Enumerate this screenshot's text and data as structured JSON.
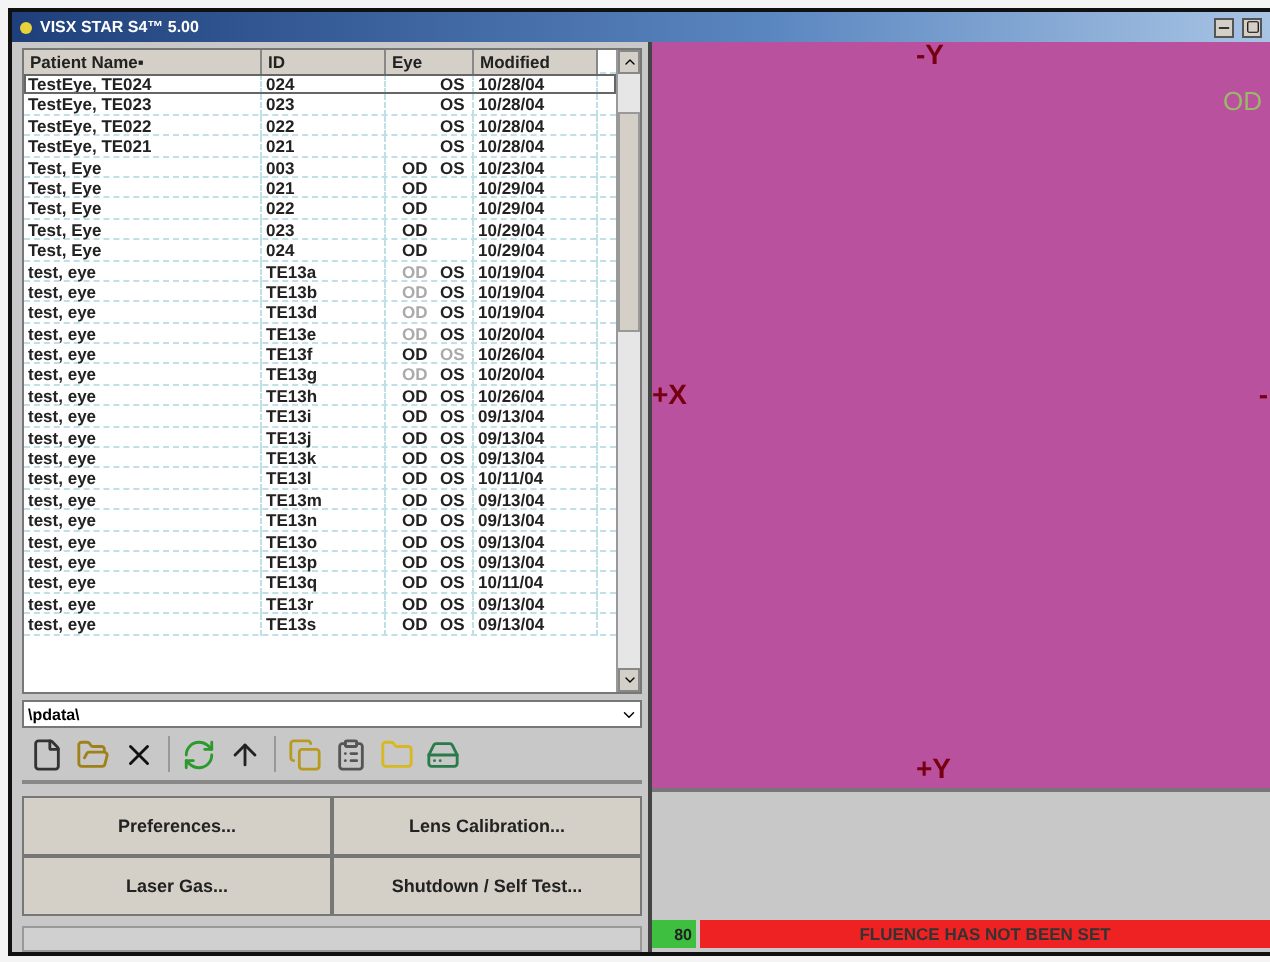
{
  "window": {
    "title": "VISX STAR S4™ 5.00"
  },
  "table": {
    "columns": [
      "Patient Name▪",
      "ID",
      "Eye",
      "Modified"
    ],
    "rows": [
      {
        "name": "TestEye, TE024",
        "id": "024",
        "os": {
          "text": "OS",
          "dimmed": false
        },
        "modified": "10/28/04",
        "selected": true
      },
      {
        "name": "TestEye, TE023",
        "id": "023",
        "os": {
          "text": "OS",
          "dimmed": false
        },
        "modified": "10/28/04",
        "selected": false
      },
      {
        "name": "TestEye, TE022",
        "id": "022",
        "os": {
          "text": "OS",
          "dimmed": false
        },
        "modified": "10/28/04",
        "selected": false
      },
      {
        "name": "TestEye, TE021",
        "id": "021",
        "os": {
          "text": "OS",
          "dimmed": false
        },
        "modified": "10/28/04",
        "selected": false
      },
      {
        "name": "Test, Eye",
        "id": "003",
        "od": {
          "text": "OD",
          "dimmed": false
        },
        "os": {
          "text": "OS",
          "dimmed": false
        },
        "modified": "10/23/04",
        "selected": false
      },
      {
        "name": "Test, Eye",
        "id": "021",
        "od": {
          "text": "OD",
          "dimmed": false
        },
        "modified": "10/29/04",
        "selected": false
      },
      {
        "name": "Test, Eye",
        "id": "022",
        "od": {
          "text": "OD",
          "dimmed": false
        },
        "modified": "10/29/04",
        "selected": false
      },
      {
        "name": "Test, Eye",
        "id": "023",
        "od": {
          "text": "OD",
          "dimmed": false
        },
        "modified": "10/29/04",
        "selected": false
      },
      {
        "name": "Test, Eye",
        "id": "024",
        "od": {
          "text": "OD",
          "dimmed": false
        },
        "modified": "10/29/04",
        "selected": false
      },
      {
        "name": "test, eye",
        "id": "TE13a",
        "od": {
          "text": "OD",
          "dimmed": true
        },
        "os": {
          "text": "OS",
          "dimmed": false
        },
        "modified": "10/19/04",
        "selected": false
      },
      {
        "name": "test, eye",
        "id": "TE13b",
        "od": {
          "text": "OD",
          "dimmed": true
        },
        "os": {
          "text": "OS",
          "dimmed": false
        },
        "modified": "10/19/04",
        "selected": false
      },
      {
        "name": "test, eye",
        "id": "TE13d",
        "od": {
          "text": "OD",
          "dimmed": true
        },
        "os": {
          "text": "OS",
          "dimmed": false
        },
        "modified": "10/19/04",
        "selected": false
      },
      {
        "name": "test, eye",
        "id": "TE13e",
        "od": {
          "text": "OD",
          "dimmed": true
        },
        "os": {
          "text": "OS",
          "dimmed": false
        },
        "modified": "10/20/04",
        "selected": false
      },
      {
        "name": "test, eye",
        "id": "TE13f",
        "od": {
          "text": "OD",
          "dimmed": false
        },
        "os": {
          "text": "OS",
          "dimmed": true
        },
        "modified": "10/26/04",
        "selected": false
      },
      {
        "name": "test, eye",
        "id": "TE13g",
        "od": {
          "text": "OD",
          "dimmed": true
        },
        "os": {
          "text": "OS",
          "dimmed": false
        },
        "modified": "10/20/04",
        "selected": false
      },
      {
        "name": "test, eye",
        "id": "TE13h",
        "od": {
          "text": "OD",
          "dimmed": false
        },
        "os": {
          "text": "OS",
          "dimmed": false
        },
        "modified": "10/26/04",
        "selected": false
      },
      {
        "name": "test, eye",
        "id": "TE13i",
        "od": {
          "text": "OD",
          "dimmed": false
        },
        "os": {
          "text": "OS",
          "dimmed": false
        },
        "modified": "09/13/04",
        "selected": false
      },
      {
        "name": "test, eye",
        "id": "TE13j",
        "od": {
          "text": "OD",
          "dimmed": false
        },
        "os": {
          "text": "OS",
          "dimmed": false
        },
        "modified": "09/13/04",
        "selected": false
      },
      {
        "name": "test, eye",
        "id": "TE13k",
        "od": {
          "text": "OD",
          "dimmed": false
        },
        "os": {
          "text": "OS",
          "dimmed": false
        },
        "modified": "09/13/04",
        "selected": false
      },
      {
        "name": "test, eye",
        "id": "TE13l",
        "od": {
          "text": "OD",
          "dimmed": false
        },
        "os": {
          "text": "OS",
          "dimmed": false
        },
        "modified": "10/11/04",
        "selected": false
      },
      {
        "name": "test, eye",
        "id": "TE13m",
        "od": {
          "text": "OD",
          "dimmed": false
        },
        "os": {
          "text": "OS",
          "dimmed": false
        },
        "modified": "09/13/04",
        "selected": false
      },
      {
        "name": "test, eye",
        "id": "TE13n",
        "od": {
          "text": "OD",
          "dimmed": false
        },
        "os": {
          "text": "OS",
          "dimmed": false
        },
        "modified": "09/13/04",
        "selected": false
      },
      {
        "name": "test, eye",
        "id": "TE13o",
        "od": {
          "text": "OD",
          "dimmed": false
        },
        "os": {
          "text": "OS",
          "dimmed": false
        },
        "modified": "09/13/04",
        "selected": false
      },
      {
        "name": "test, eye",
        "id": "TE13p",
        "od": {
          "text": "OD",
          "dimmed": false
        },
        "os": {
          "text": "OS",
          "dimmed": false
        },
        "modified": "09/13/04",
        "selected": false
      },
      {
        "name": "test, eye",
        "id": "TE13q",
        "od": {
          "text": "OD",
          "dimmed": false
        },
        "os": {
          "text": "OS",
          "dimmed": false
        },
        "modified": "10/11/04",
        "selected": false
      },
      {
        "name": "test, eye",
        "id": "TE13r",
        "od": {
          "text": "OD",
          "dimmed": false
        },
        "os": {
          "text": "OS",
          "dimmed": false
        },
        "modified": "09/13/04",
        "selected": false
      },
      {
        "name": "test, eye",
        "id": "TE13s",
        "od": {
          "text": "OD",
          "dimmed": false
        },
        "os": {
          "text": "OS",
          "dimmed": false
        },
        "modified": "09/13/04",
        "selected": false
      }
    ]
  },
  "path_field": {
    "value": "\\pdata\\"
  },
  "buttons": [
    {
      "label": "Preferences..."
    },
    {
      "label": "Lens Calibration..."
    },
    {
      "label": "Laser Gas..."
    },
    {
      "label": "Shutdown / Self Test..."
    }
  ],
  "viewer": {
    "eye_label": "OD",
    "top": "-Y",
    "left": "+X",
    "right": "-",
    "bottom": "+Y"
  },
  "status_bar": {
    "reading": "80",
    "message": "FLUENCE HAS NOT BEEN SET"
  }
}
